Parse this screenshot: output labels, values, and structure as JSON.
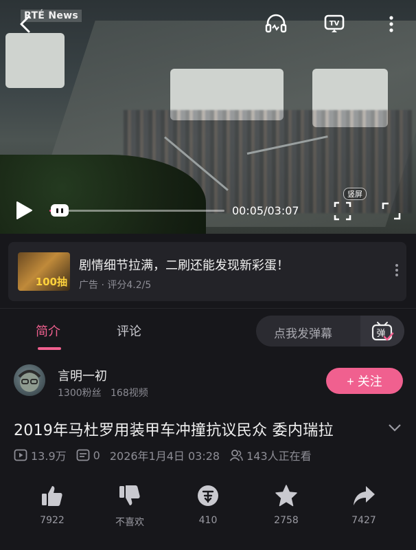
{
  "video": {
    "logo_text": "RTÉ News",
    "current_time": "00:05",
    "duration": "03:07",
    "time_display": "00:05/03:07",
    "progress_fraction": 0.027,
    "vertical_badge": "竖屏"
  },
  "ad": {
    "title": "剧情细节拉满，二刷还能发现新彩蛋！",
    "meta": "广告 · 评分4.2/5",
    "thumb_text": "100抽"
  },
  "tabs": [
    {
      "label": "简介",
      "active": true
    },
    {
      "label": "评论",
      "active": false
    }
  ],
  "danmu": {
    "placeholder": "点我发弹幕",
    "toggle_label": "弹"
  },
  "uploader": {
    "name": "言明一初",
    "fans": "1300粉丝",
    "videos": "168视频",
    "follow_label": "+ 关注"
  },
  "video_info": {
    "title": "2019年马杜罗用装甲车冲撞抗议民众 委内瑞拉",
    "views": "13.9万",
    "danmaku_count": "0",
    "date": "2026年1月4日 03:28",
    "watching": "143人正在看"
  },
  "actions": [
    {
      "icon": "thumbs-up-icon",
      "label": "7922"
    },
    {
      "icon": "thumbs-down-icon",
      "label": "不喜欢"
    },
    {
      "icon": "coin-icon",
      "label": "410"
    },
    {
      "icon": "star-icon",
      "label": "2758"
    },
    {
      "icon": "share-icon",
      "label": "7427"
    }
  ],
  "colors": {
    "accent": "#f0608f",
    "background": "#17171b",
    "card": "#232328"
  }
}
